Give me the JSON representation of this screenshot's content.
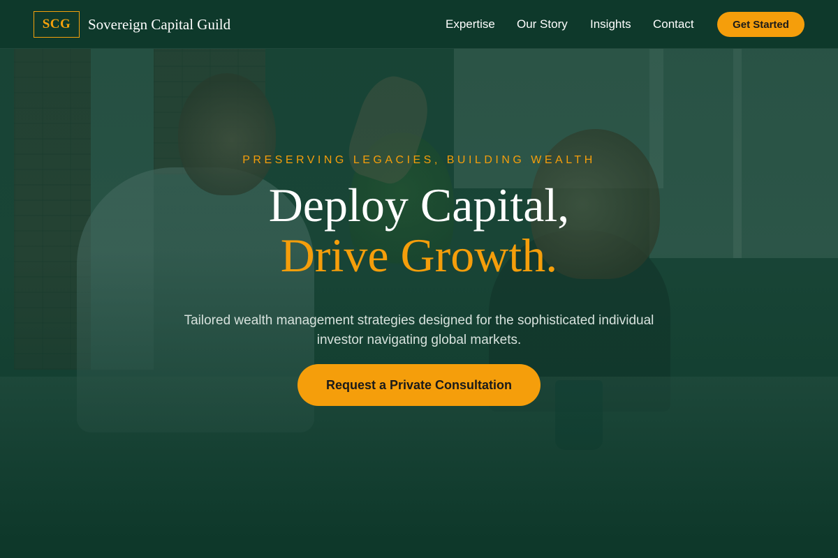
{
  "brand": {
    "logo_text": "SCG",
    "name": "Sovereign Capital Guild"
  },
  "nav": {
    "links": [
      "Expertise",
      "Our Story",
      "Insights",
      "Contact"
    ],
    "cta_label": "Get Started"
  },
  "hero": {
    "eyebrow": "PRESERVING LEGACIES, BUILDING WEALTH",
    "headline_line1": "Deploy Capital,",
    "headline_line2": "Drive Growth.",
    "subtext": "Tailored wealth management strategies designed for the sophisticated individual investor navigating global markets.",
    "cta_label": "Request a Private Consultation",
    "background_image": "business-partners-high-five"
  },
  "colors": {
    "accent": "#f59e0b",
    "overlay": "#0e3a2c",
    "text_light": "#ffffff"
  }
}
